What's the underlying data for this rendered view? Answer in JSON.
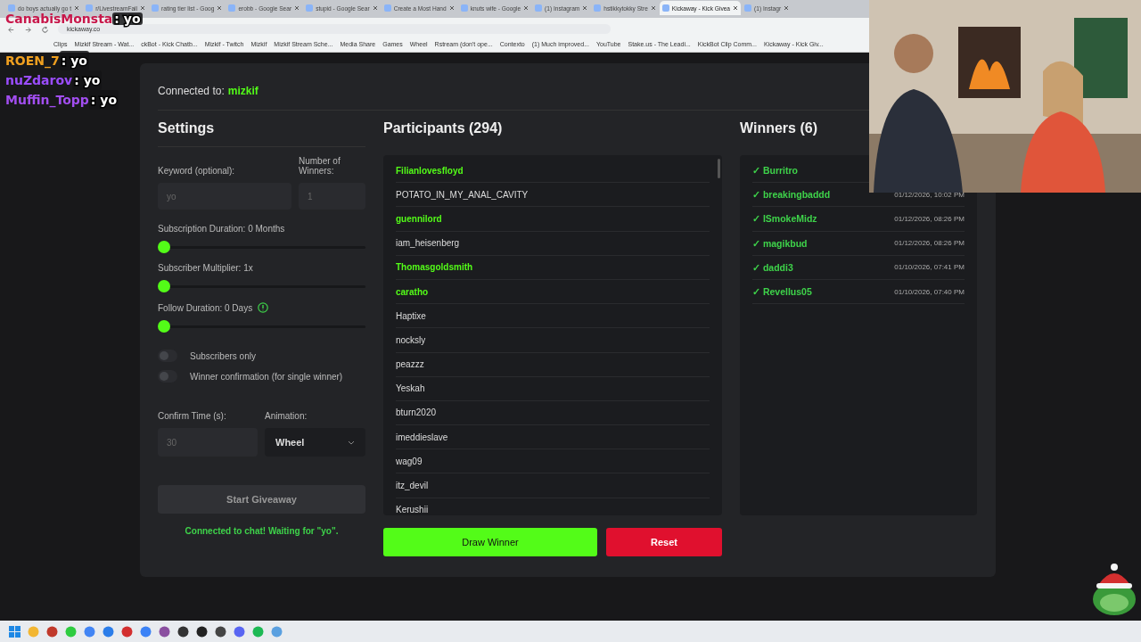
{
  "browser": {
    "tabs": [
      {
        "title": "do boys actually go t",
        "selected": false
      },
      {
        "title": "r/LivestreamFail",
        "selected": false
      },
      {
        "title": "rating tier list - Goog",
        "selected": false
      },
      {
        "title": "erobb - Google Sear",
        "selected": false
      },
      {
        "title": "stupid - Google Sear",
        "selected": false
      },
      {
        "title": "Create a Most Hand",
        "selected": false
      },
      {
        "title": "knuts wife - Google",
        "selected": false
      },
      {
        "title": "(1) Instagram",
        "selected": false
      },
      {
        "title": "hstikkytokky Stre",
        "selected": false
      },
      {
        "title": "Kickaway - Kick Givea",
        "selected": true
      },
      {
        "title": "(1) Instagr",
        "selected": false
      }
    ],
    "address": "kickaway.co",
    "bookmarks": [
      "Clips",
      "Mizkif Stream - Wat...",
      "ckBot - Kick Chatb...",
      "Mizkif - Twitch",
      "Mizkif",
      "Mizkif Stream Sche...",
      "Media Share",
      "Games",
      "Wheel",
      "Rstream (don't ope...",
      "Contexto",
      "(1) Much improved...",
      "YouTube",
      "Stake.us - The Leadi...",
      "KickBot Clip Comm...",
      "Kickaway - Kick Giv..."
    ]
  },
  "chat_overlay": [
    {
      "user": "CanabisMonsta",
      "message": ": yo",
      "color": "#c8174a"
    },
    {
      "user": "ROEN_7",
      "message": ": yo",
      "color": "#f0a020"
    },
    {
      "user": "nuZdarov",
      "message": ": yo",
      "color": "#9b4dff"
    },
    {
      "user": "Muffin_Topp",
      "message": ": yo",
      "color": "#a24ef0"
    }
  ],
  "app": {
    "connected_label": "Connected to:",
    "channel": "mizkif",
    "settings": {
      "title": "Settings",
      "keyword": {
        "label": "Keyword (optional):",
        "placeholder": "yo"
      },
      "winners_count": {
        "label": "Number of Winners:",
        "placeholder": "1"
      },
      "sliders": [
        {
          "label": "Subscription Duration: 0 Months",
          "level": 0,
          "info": false
        },
        {
          "label": "Subscriber Multiplier: 1x",
          "level": 0,
          "info": false
        },
        {
          "label": "Follow Duration: 0 Days",
          "level": 0,
          "info": true
        }
      ],
      "toggles": [
        {
          "label": "Subscribers only",
          "on": false
        },
        {
          "label": "Winner confirmation (for single winner)",
          "on": false
        }
      ],
      "confirm_time": {
        "label": "Confirm Time (s):",
        "placeholder": "30"
      },
      "animation": {
        "label": "Animation:",
        "value": "Wheel"
      },
      "start_button": {
        "label": "Start Giveaway",
        "disabled": true
      },
      "status": "Connected to chat! Waiting for \"yo\"."
    },
    "participants": {
      "title": "Participants (294)",
      "items": [
        {
          "name": "Filianlovesfloyd",
          "highlighted": true
        },
        {
          "name": "POTATO_IN_MY_ANAL_CAVITY",
          "highlighted": false
        },
        {
          "name": "guennilord",
          "highlighted": true
        },
        {
          "name": "iam_heisenberg",
          "highlighted": false
        },
        {
          "name": "Thomasgoldsmith",
          "highlighted": true
        },
        {
          "name": "caratho",
          "highlighted": true
        },
        {
          "name": "Haptixe",
          "highlighted": false
        },
        {
          "name": "nocksly",
          "highlighted": false
        },
        {
          "name": "peazzz",
          "highlighted": false
        },
        {
          "name": "Yeskah",
          "highlighted": false
        },
        {
          "name": "bturn2020",
          "highlighted": false
        },
        {
          "name": "imeddieslave",
          "highlighted": false
        },
        {
          "name": "wag09",
          "highlighted": false
        },
        {
          "name": "itz_devil",
          "highlighted": false
        },
        {
          "name": "Kerushii",
          "highlighted": false
        }
      ]
    },
    "winners": {
      "title": "Winners (6)",
      "items": [
        {
          "name": "✓ Burritro"
        },
        {
          "name": "✓ breakingbaddd",
          "time": "01/12/2026, 10:02 PM"
        },
        {
          "name": "✓ ISmokeMidz",
          "time": "01/12/2026, 08:26 PM"
        },
        {
          "name": "✓ magikbud",
          "time": "01/12/2026, 08:26 PM"
        },
        {
          "name": "✓ daddi3",
          "time": "01/10/2026, 07:41 PM"
        },
        {
          "name": "✓ Revellus05",
          "time": "01/10/2026, 07:40 PM"
        }
      ]
    },
    "draw_button": "Draw Winner",
    "reset_button": "Reset"
  }
}
